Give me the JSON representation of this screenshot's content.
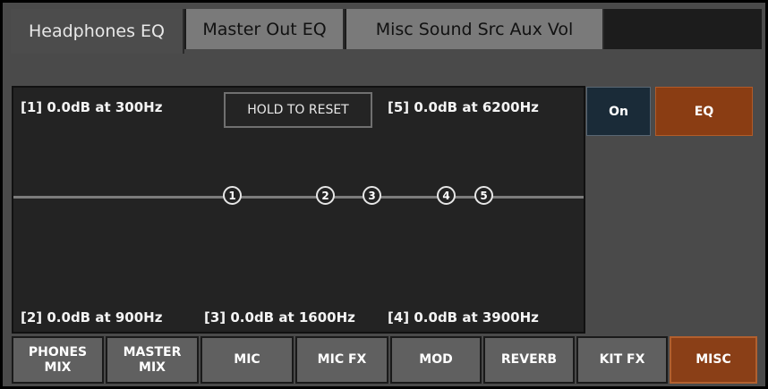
{
  "tabs": [
    {
      "label": "Headphones EQ",
      "active": true
    },
    {
      "label": "Master Out EQ",
      "active": false
    },
    {
      "label": "Misc Sound Src Aux Vol",
      "active": false
    }
  ],
  "eq": {
    "reset_label": "HOLD TO RESET",
    "bands": [
      {
        "id": "1",
        "label": "[1] 0.0dB at 300Hz"
      },
      {
        "id": "2",
        "label": "[2] 0.0dB at 900Hz"
      },
      {
        "id": "3",
        "label": "[3] 0.0dB at 1600Hz"
      },
      {
        "id": "4",
        "label": "[4] 0.0dB at 3900Hz"
      },
      {
        "id": "5",
        "label": "[5] 0.0dB at 6200Hz"
      }
    ]
  },
  "controls": {
    "on_label": "On",
    "eq_label": "EQ"
  },
  "nav": [
    {
      "label": "PHONES\nMIX",
      "active": false
    },
    {
      "label": "MASTER\nMIX",
      "active": false
    },
    {
      "label": "MIC",
      "active": false
    },
    {
      "label": "MIC FX",
      "active": false
    },
    {
      "label": "MOD",
      "active": false
    },
    {
      "label": "REVERB",
      "active": false
    },
    {
      "label": "KIT FX",
      "active": false
    },
    {
      "label": "MISC",
      "active": true
    }
  ],
  "colors": {
    "accent": "#8a3d13",
    "on_button": "#1a2b38",
    "graph_bg": "#232323"
  }
}
